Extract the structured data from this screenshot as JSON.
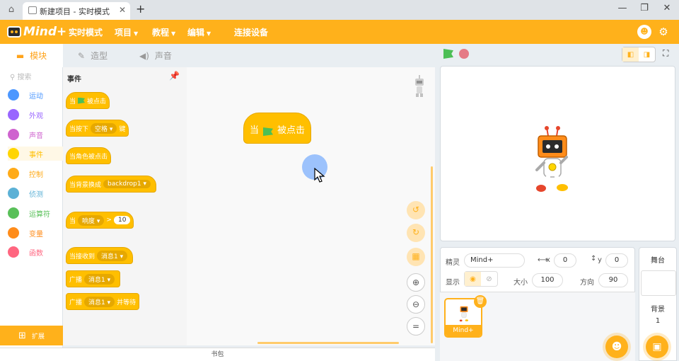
{
  "browser": {
    "tab_title": "新建项目 - 实时模式",
    "close": "✕",
    "new_tab": "+"
  },
  "header": {
    "logo": "Mind+",
    "menu": [
      {
        "label": "实时模式",
        "caret": ""
      },
      {
        "label": "项目",
        "caret": "▼"
      },
      {
        "label": "教程",
        "caret": "▼"
      },
      {
        "label": "编辑",
        "caret": "▼"
      },
      {
        "label": "连接设备",
        "caret": ""
      }
    ]
  },
  "subtabs": [
    {
      "label": "模块",
      "icon": "blocks-icon"
    },
    {
      "label": "造型",
      "icon": "brush-icon"
    },
    {
      "label": "声音",
      "icon": "speaker-icon"
    }
  ],
  "categories": {
    "search_placeholder": "搜索",
    "items": [
      {
        "label": "运动",
        "color": "#4c97ff"
      },
      {
        "label": "外观",
        "color": "#9966ff"
      },
      {
        "label": "声音",
        "color": "#cf63cf"
      },
      {
        "label": "事件",
        "color": "#ffd500"
      },
      {
        "label": "控制",
        "color": "#ffab19"
      },
      {
        "label": "侦测",
        "color": "#5cb1d6"
      },
      {
        "label": "运算符",
        "color": "#59c059"
      },
      {
        "label": "变量",
        "color": "#ff8c1a"
      },
      {
        "label": "函数",
        "color": "#ff6680"
      }
    ],
    "extension": "扩展"
  },
  "palette": {
    "title": "事件",
    "blocks": {
      "flag_clicked_pre": "当",
      "flag_clicked_post": "被点击",
      "key_pressed_pre": "当按下",
      "key_pressed_key": "空格",
      "key_pressed_post": "键",
      "sprite_clicked": "当角色被点击",
      "backdrop_switch": "当背景换成",
      "backdrop_value": "backdrop1",
      "loudness_pre": "当",
      "loudness_dd": "响度",
      "loudness_op": ">",
      "loudness_value": "10",
      "receive_pre": "当接收到",
      "receive_value": "消息1",
      "broadcast_pre": "广播",
      "broadcast_value": "消息1",
      "broadcast_wait_pre": "广播",
      "broadcast_wait_value": "消息1",
      "broadcast_wait_post": "并等待"
    }
  },
  "script": {
    "hat_pre": "当",
    "hat_post": "被点击"
  },
  "bottom": {
    "bag": "书包"
  },
  "sprite_info": {
    "sprite_label": "精灵",
    "sprite_name": "Mind+",
    "x_label": "x",
    "x_value": "0",
    "y_label": "y",
    "y_value": "0",
    "show_label": "显示",
    "size_label": "大小",
    "size_value": "100",
    "direction_label": "方向",
    "direction_value": "90",
    "card_name": "Mind+"
  },
  "stage_panel": {
    "title": "舞台",
    "backdrop_label": "背景",
    "backdrop_count": "1"
  },
  "colors": {
    "brand": "#ffb11b",
    "event_block": "#ffbf00",
    "green_flag": "#4cbf56",
    "stop": "#e57a86"
  }
}
